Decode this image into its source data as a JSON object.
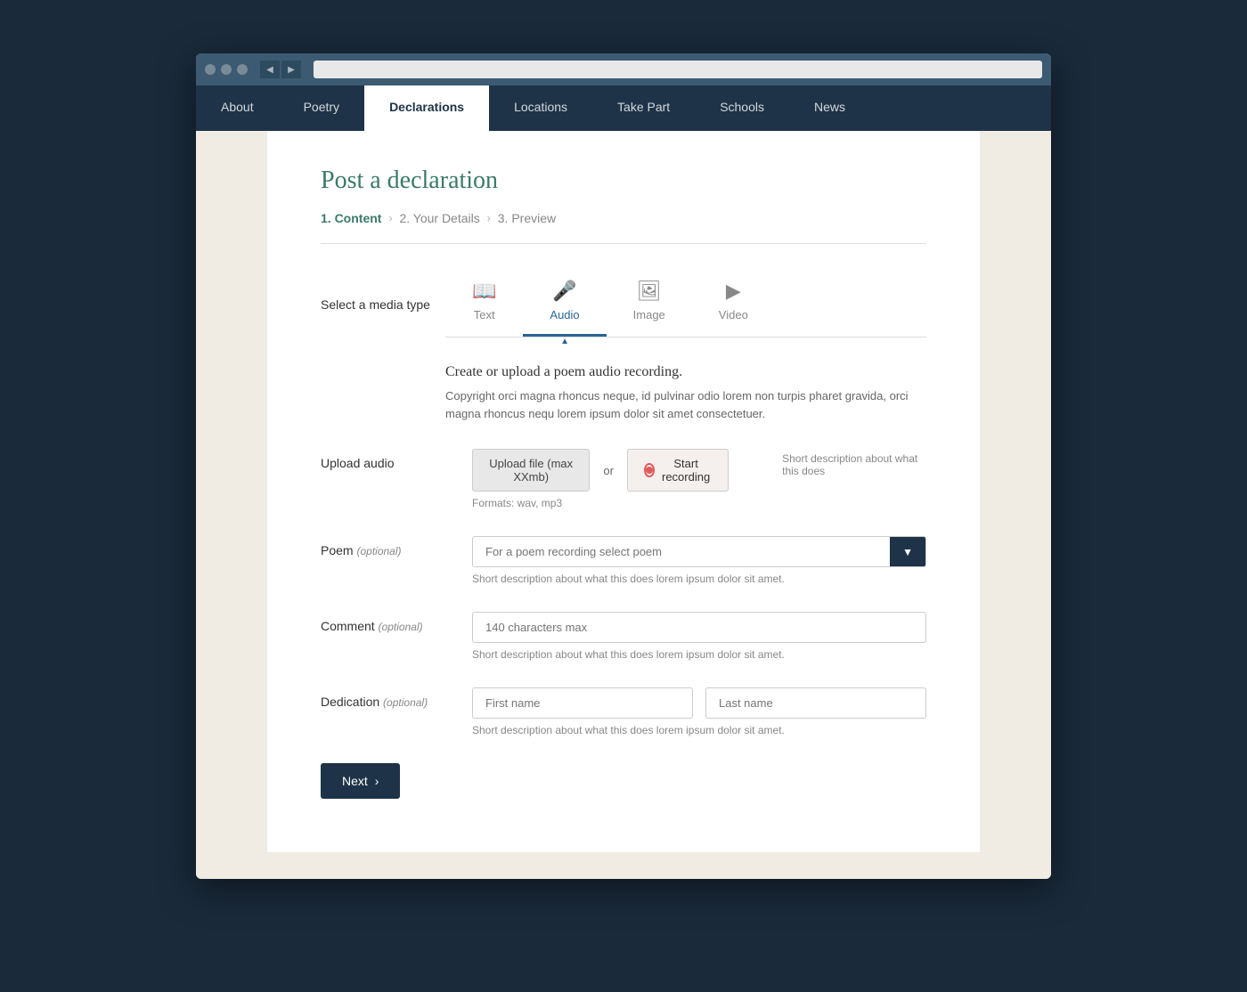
{
  "browser": {
    "dots": [
      "dot1",
      "dot2",
      "dot3"
    ]
  },
  "nav": {
    "items": [
      {
        "id": "about",
        "label": "About",
        "active": false
      },
      {
        "id": "poetry",
        "label": "Poetry",
        "active": false
      },
      {
        "id": "declarations",
        "label": "Declarations",
        "active": true
      },
      {
        "id": "locations",
        "label": "Locations",
        "active": false
      },
      {
        "id": "take-part",
        "label": "Take Part",
        "active": false
      },
      {
        "id": "schools",
        "label": "Schools",
        "active": false
      },
      {
        "id": "news",
        "label": "News",
        "active": false
      }
    ]
  },
  "page": {
    "title": "Post a declaration",
    "breadcrumb": {
      "step1": "1. Content",
      "step2": "2. Your Details",
      "step3": "3. Preview"
    }
  },
  "media_type": {
    "label": "Select a media type",
    "tabs": [
      {
        "id": "text",
        "label": "Text",
        "icon": "📖"
      },
      {
        "id": "audio",
        "label": "Audio",
        "icon": "🎤",
        "active": true
      },
      {
        "id": "image",
        "label": "Image",
        "icon": "🖼"
      },
      {
        "id": "video",
        "label": "Video",
        "icon": "▶"
      }
    ]
  },
  "audio_section": {
    "title": "Create or upload a poem audio recording.",
    "description": "Copyright orci magna rhoncus neque, id pulvinar odio lorem non turpis pharet gravida, orci magna rhoncus nequ lorem ipsum dolor sit amet consectetuer."
  },
  "form": {
    "upload_audio": {
      "label": "Upload audio",
      "upload_btn": "Upload file (max XXmb)",
      "or_text": "or",
      "record_btn": "Start recording",
      "format_text": "Formats: wav, mp3",
      "record_desc": "Short description about what this does"
    },
    "poem": {
      "label": "Poem",
      "optional": "(optional)",
      "placeholder": "For a poem recording select poem",
      "description": "Short description about what this does lorem ipsum dolor sit amet."
    },
    "comment": {
      "label": "Comment",
      "optional": "(optional)",
      "placeholder": "140 characters max",
      "description": "Short description about what this does lorem ipsum dolor sit amet."
    },
    "dedication": {
      "label": "Dedication",
      "optional": "(optional)",
      "first_name_placeholder": "First name",
      "last_name_placeholder": "Last name",
      "description": "Short description about what this does lorem ipsum dolor sit amet."
    },
    "next_btn": "Next"
  }
}
